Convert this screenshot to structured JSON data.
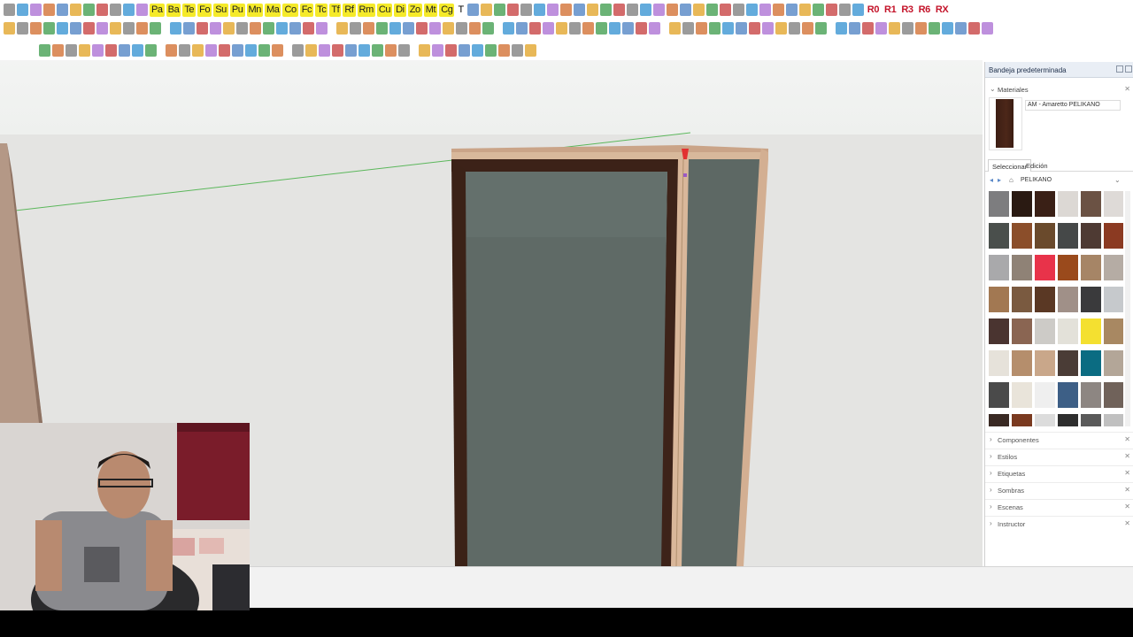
{
  "toolbar": {
    "row1_labels": [
      "Pa",
      "Ba",
      "Te",
      "Fo",
      "Su",
      "Pu",
      "Mn",
      "Ma",
      "Co",
      "Fc",
      "Tc",
      "Tf",
      "Rf",
      "Rm",
      "Cu",
      "Di",
      "Zo",
      "Mt",
      "Cg",
      "T",
      "R0",
      "R1",
      "R3",
      "R6",
      "RX"
    ],
    "icon_color_pattern": [
      "#4a7fc1",
      "#e0a020",
      "#3a9a48",
      "#c43a3a",
      "#7a7a7a",
      "#2f8fd0",
      "#a86bd1",
      "#d06a2a"
    ]
  },
  "tray": {
    "title": "Bandeja predeterminada",
    "materials_header": "Materiales",
    "current_material": "AM - Amaretto PELIKANO",
    "tab_select": "Seleccionar",
    "tab_edit": "Edición",
    "collection": "PELIKANO",
    "sections": [
      "Componentes",
      "Estilos",
      "Etiquetas",
      "Sombras",
      "Escenas",
      "Instructor"
    ],
    "swatch_colors": [
      [
        "#7d7d7f",
        "#2a1a12",
        "#3a2016",
        "#dcd8d4",
        "#6b5244",
        "#dedad7"
      ],
      [
        "#4a4f4c",
        "#8b4e2a",
        "#6a4a2c",
        "#454848",
        "#4e3a33",
        "#8b3a22"
      ],
      [
        "#a9a9ab",
        "#8f8276",
        "#e8334a",
        "#9a4a1c",
        "#a68566",
        "#b5aca4"
      ],
      [
        "#a27852",
        "#7a5a40",
        "#5a3824",
        "#a09088",
        "#3a3a3c",
        "#c6c9cc"
      ],
      [
        "#4a3430",
        "#8a6552",
        "#cdcbc7",
        "#e3e1d9",
        "#f4e030",
        "#a88862"
      ],
      [
        "#e6e2da",
        "#b58e6c",
        "#c9a78a",
        "#4a3c36",
        "#0b6c82",
        "#b3a698"
      ],
      [
        "#4a4a4a",
        "#e9e4da",
        "#efefef",
        "#3d5f86",
        "#8d8682",
        "#70625a"
      ],
      [
        "#3a2a24",
        "#7a3a20",
        "#dcdcdc",
        "#2e2e2e",
        "#5a5a5a",
        "#c0c0c0"
      ]
    ]
  },
  "scene": {
    "cabinet_front_color": "#606b67",
    "frame_color": "#3b2217",
    "edge_color": "#d6b396"
  }
}
